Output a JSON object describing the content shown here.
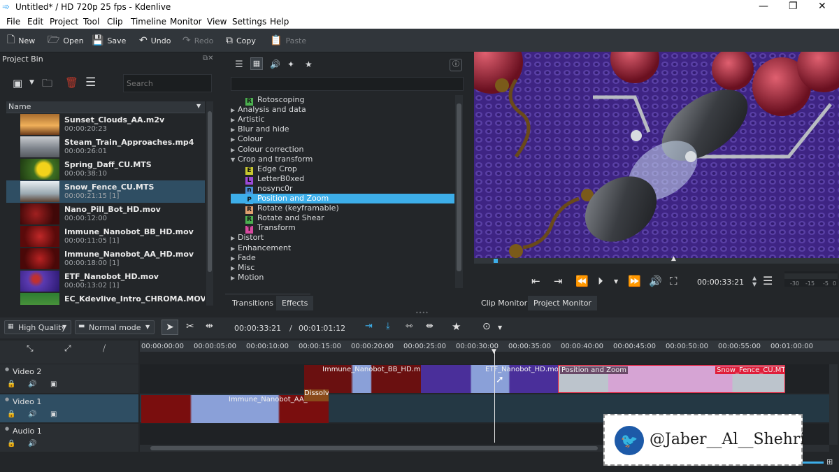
{
  "window": {
    "title": "Untitled* / HD 720p 25 fps - Kdenlive"
  },
  "menu": [
    "File",
    "Edit",
    "Project",
    "Tool",
    "Clip",
    "Timeline",
    "Monitor",
    "View",
    "Settings",
    "Help"
  ],
  "toolbar": {
    "new": "New",
    "open": "Open",
    "save": "Save",
    "undo": "Undo",
    "redo": "Redo",
    "copy": "Copy",
    "paste": "Paste"
  },
  "project_bin": {
    "title": "Project Bin",
    "search_placeholder": "Search",
    "column": "Name",
    "clips": [
      {
        "name": "Sunset_Clouds_AA.m2v",
        "duration": "00:00:20:23"
      },
      {
        "name": "Steam_Train_Approaches.mp4",
        "duration": "00:00:26:01"
      },
      {
        "name": "Spring_Daff_CU.MTS",
        "duration": "00:00:38:10"
      },
      {
        "name": "Snow_Fence_CU.MTS",
        "duration": "00:00:21:15  [1]"
      },
      {
        "name": "Nano_Pill_Bot_HD.mov",
        "duration": "00:00:12:00"
      },
      {
        "name": "Immune_Nanobot_BB_HD.mov",
        "duration": "00:00:11:05  [1]"
      },
      {
        "name": "Immune_Nanobot_AA_HD.mov",
        "duration": "00:00:18:00  [1]"
      },
      {
        "name": "ETF_Nanobot_HD.mov",
        "duration": "00:00:13:02  [1]"
      },
      {
        "name": "EC_Kdevlive_Intro_CHROMA.MOV",
        "duration": ""
      }
    ],
    "selected_index": 3
  },
  "effects": {
    "rows": [
      {
        "type": "effect",
        "badge": "R",
        "color": "#4caf50",
        "label": "Rotoscoping"
      },
      {
        "type": "group",
        "label": "Analysis and data",
        "open": false
      },
      {
        "type": "group",
        "label": "Artistic",
        "open": false
      },
      {
        "type": "group",
        "label": "Blur and hide",
        "open": false
      },
      {
        "type": "group",
        "label": "Colour",
        "open": false
      },
      {
        "type": "group",
        "label": "Colour correction",
        "open": false
      },
      {
        "type": "group",
        "label": "Crop and transform",
        "open": true
      },
      {
        "type": "effect",
        "badge": "E",
        "color": "#c8c830",
        "label": "Edge Crop"
      },
      {
        "type": "effect",
        "badge": "L",
        "color": "#9c4ad8",
        "label": "LetterB0xed"
      },
      {
        "type": "effect",
        "badge": "n",
        "color": "#4a90d8",
        "label": "nosync0r"
      },
      {
        "type": "effect",
        "badge": "P",
        "color": "#3daee9",
        "label": "Position and Zoom",
        "selected": true
      },
      {
        "type": "effect",
        "badge": "R",
        "color": "#e0a070",
        "label": "Rotate (keyframable)"
      },
      {
        "type": "effect",
        "badge": "R",
        "color": "#4caf50",
        "label": "Rotate and Shear"
      },
      {
        "type": "effect",
        "badge": "T",
        "color": "#d84aa0",
        "label": "Transform"
      },
      {
        "type": "group",
        "label": "Distort",
        "open": false
      },
      {
        "type": "group",
        "label": "Enhancement",
        "open": false
      },
      {
        "type": "group",
        "label": "Fade",
        "open": false
      },
      {
        "type": "group",
        "label": "Misc",
        "open": false
      },
      {
        "type": "group",
        "label": "Motion",
        "open": false
      }
    ],
    "tabs": [
      "Transitions",
      "Effects"
    ]
  },
  "monitor": {
    "timecode": "00:00:33:21",
    "tabs": [
      "Clip Monitor",
      "Project Monitor"
    ],
    "audio_scale": [
      "-30",
      "-15",
      "-5",
      "0"
    ]
  },
  "timeline": {
    "quality": "High Quality",
    "mode": "Normal mode",
    "position": "00:00:33:21",
    "duration": "00:01:01:12",
    "ruler": [
      "00:00:00:00",
      "00:00:05:00",
      "00:00:10:00",
      "00:00:15:00",
      "00:00:20:00",
      "00:00:25:00",
      "00:00:30:00",
      "00:00:35:00",
      "00:00:40:00",
      "00:00:45:00",
      "00:00:50:00",
      "00:00:55:00",
      "00:01:00:00"
    ],
    "tracks": [
      "Video 2",
      "Video 1",
      "Audio 1"
    ],
    "clips": {
      "bb": "Immune_Nanobot_BB_HD.mov",
      "etf": "ETF_Nanobot_HD.mov",
      "pz": "Position and Zoom",
      "snow": "Snow_Fence_CU.MTS",
      "aa": "Immune_Nanobot_AA_H",
      "dissolve": "Dissolve"
    }
  },
  "watermark": {
    "handle": "@Jaber__Al__Shehri"
  }
}
